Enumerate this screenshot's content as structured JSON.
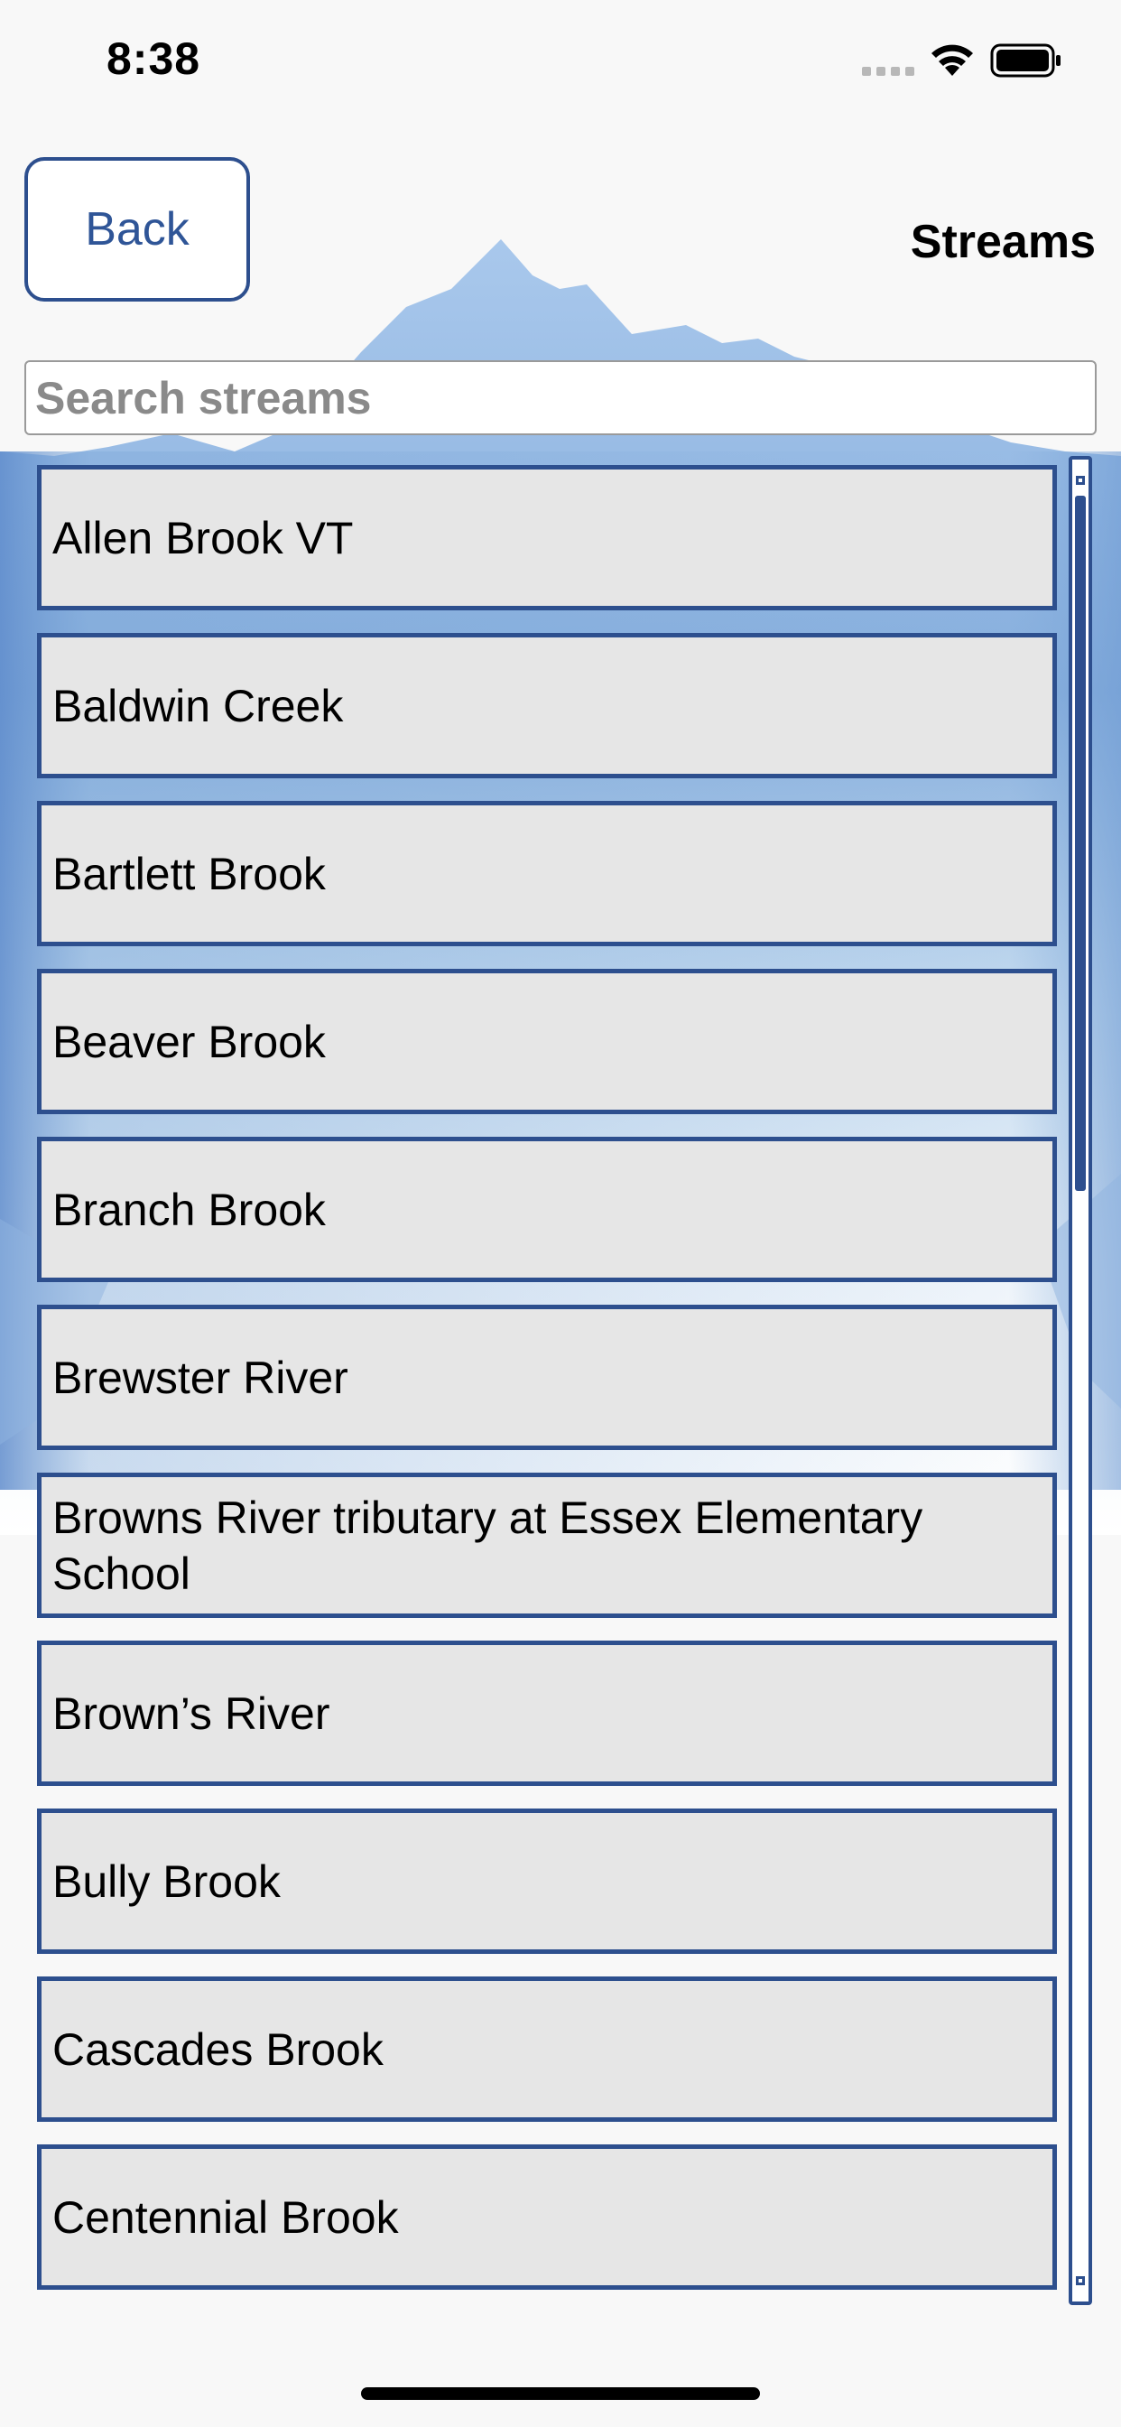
{
  "status_bar": {
    "time": "8:38"
  },
  "header": {
    "back_label": "Back",
    "title": "Streams"
  },
  "search": {
    "placeholder": "Search streams",
    "value": ""
  },
  "streams": [
    "Allen Brook VT",
    "Baldwin Creek",
    "Bartlett Brook",
    "Beaver Brook",
    "Branch Brook",
    "Brewster River",
    "Browns River tributary at Essex Elementary School",
    "Brown’s River",
    "Bully Brook",
    "Cascades Brook",
    "Centennial Brook"
  ],
  "colors": {
    "accent": "#2d4f8e",
    "item_background": "#e6e6e6",
    "page_background": "#f8f8f8",
    "sky_blue": "#7ea8d8"
  },
  "icons": {
    "signal": "cellular-signal-icon",
    "wifi": "wifi-icon",
    "battery": "battery-icon"
  }
}
